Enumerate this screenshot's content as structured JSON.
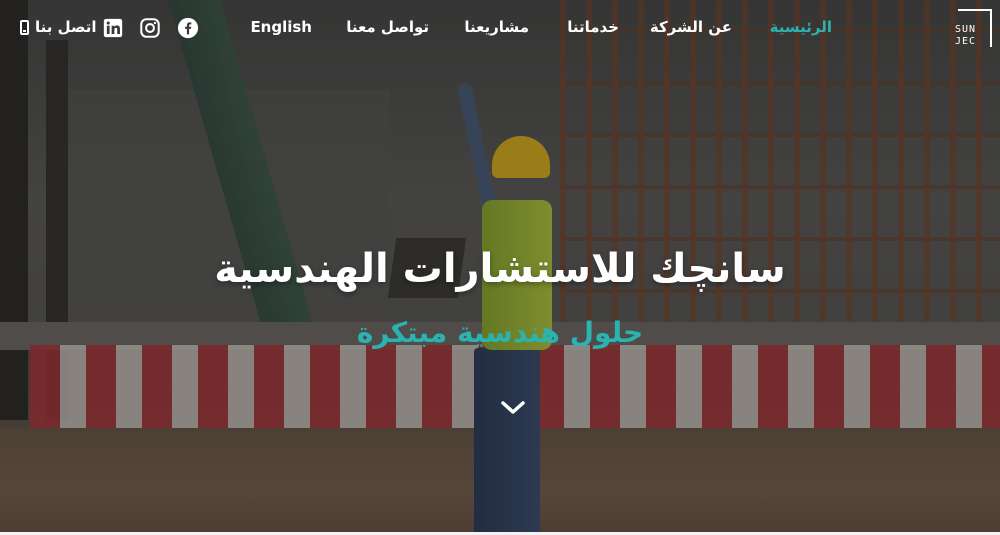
{
  "brand": {
    "logo_line1": "SUN",
    "logo_line2": "JEC"
  },
  "nav": {
    "items": [
      {
        "label": "الرئيسية",
        "active": true
      },
      {
        "label": "عن الشركة",
        "active": false
      },
      {
        "label": "خدماتنا",
        "active": false
      },
      {
        "label": "مشاريعنا",
        "active": false
      },
      {
        "label": "تواصل معنا",
        "active": false
      }
    ],
    "language": "English",
    "social": [
      "facebook-icon",
      "instagram-icon",
      "linkedin-icon"
    ],
    "contact": {
      "label": "اتصل بنا",
      "icon": "phone-icon"
    }
  },
  "hero": {
    "title": "سانچك للاستشارات الهندسية",
    "subtitle": "حلول هندسية مبتكرة",
    "scroll_icon": "chevron-down-icon"
  },
  "colors": {
    "accent": "#2bb3b1",
    "text": "#ffffff"
  }
}
